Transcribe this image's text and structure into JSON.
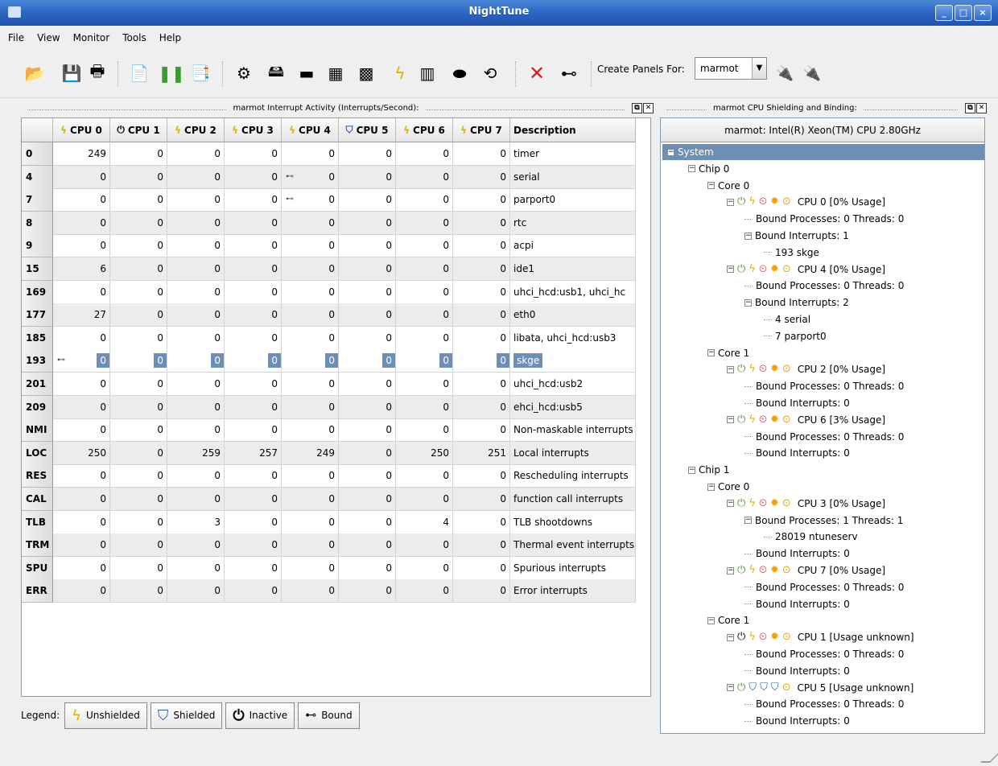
{
  "window": {
    "title": "NightTune",
    "controls": [
      "_",
      "□",
      "×"
    ]
  },
  "menu": [
    "File",
    "View",
    "Monitor",
    "Tools",
    "Help"
  ],
  "toolbar": {
    "create_panels_label": "Create Panels For:",
    "host": "marmot"
  },
  "interrupts_panel": {
    "title": "marmot Interrupt Activity (Interrupts/Second):",
    "columns": [
      "CPU 0",
      "CPU 1",
      "CPU 2",
      "CPU 3",
      "CPU 4",
      "CPU 5",
      "CPU 6",
      "CPU 7",
      "Description"
    ],
    "column_state": [
      "unshielded",
      "inactive",
      "unshielded",
      "unshielded",
      "unshielded",
      "shielded",
      "unshielded",
      "unshielded"
    ],
    "rows": [
      {
        "irq": "0",
        "values": [
          "249",
          "0",
          "0",
          "0",
          "0",
          "0",
          "0",
          "0"
        ],
        "desc": "timer"
      },
      {
        "irq": "4",
        "values": [
          "0",
          "0",
          "0",
          "0",
          "0",
          "0",
          "0",
          "0"
        ],
        "desc": "serial",
        "bound_cpu": 4
      },
      {
        "irq": "7",
        "values": [
          "0",
          "0",
          "0",
          "0",
          "0",
          "0",
          "0",
          "0"
        ],
        "desc": "parport0",
        "bound_cpu": 4
      },
      {
        "irq": "8",
        "values": [
          "0",
          "0",
          "0",
          "0",
          "0",
          "0",
          "0",
          "0"
        ],
        "desc": "rtc"
      },
      {
        "irq": "9",
        "values": [
          "0",
          "0",
          "0",
          "0",
          "0",
          "0",
          "0",
          "0"
        ],
        "desc": "acpi"
      },
      {
        "irq": "15",
        "values": [
          "6",
          "0",
          "0",
          "0",
          "0",
          "0",
          "0",
          "0"
        ],
        "desc": "ide1"
      },
      {
        "irq": "169",
        "values": [
          "0",
          "0",
          "0",
          "0",
          "0",
          "0",
          "0",
          "0"
        ],
        "desc": "uhci_hcd:usb1, uhci_hc"
      },
      {
        "irq": "177",
        "values": [
          "27",
          "0",
          "0",
          "0",
          "0",
          "0",
          "0",
          "0"
        ],
        "desc": "eth0"
      },
      {
        "irq": "185",
        "values": [
          "0",
          "0",
          "0",
          "0",
          "0",
          "0",
          "0",
          "0"
        ],
        "desc": "libata, uhci_hcd:usb3"
      },
      {
        "irq": "193",
        "values": [
          "0",
          "0",
          "0",
          "0",
          "0",
          "0",
          "0",
          "0"
        ],
        "desc": "skge",
        "selected": true,
        "bound_cpu": 0
      },
      {
        "irq": "201",
        "values": [
          "0",
          "0",
          "0",
          "0",
          "0",
          "0",
          "0",
          "0"
        ],
        "desc": "uhci_hcd:usb2"
      },
      {
        "irq": "209",
        "values": [
          "0",
          "0",
          "0",
          "0",
          "0",
          "0",
          "0",
          "0"
        ],
        "desc": "ehci_hcd:usb5"
      },
      {
        "irq": "NMI",
        "values": [
          "0",
          "0",
          "0",
          "0",
          "0",
          "0",
          "0",
          "0"
        ],
        "desc": "Non-maskable interrupts"
      },
      {
        "irq": "LOC",
        "values": [
          "250",
          "0",
          "259",
          "257",
          "249",
          "0",
          "250",
          "251"
        ],
        "desc": "Local interrupts"
      },
      {
        "irq": "RES",
        "values": [
          "0",
          "0",
          "0",
          "0",
          "0",
          "0",
          "0",
          "0"
        ],
        "desc": "Rescheduling interrupts"
      },
      {
        "irq": "CAL",
        "values": [
          "0",
          "0",
          "0",
          "0",
          "0",
          "0",
          "0",
          "0"
        ],
        "desc": "function call interrupts"
      },
      {
        "irq": "TLB",
        "values": [
          "0",
          "0",
          "3",
          "0",
          "0",
          "0",
          "4",
          "0"
        ],
        "desc": "TLB shootdowns"
      },
      {
        "irq": "TRM",
        "values": [
          "0",
          "0",
          "0",
          "0",
          "0",
          "0",
          "0",
          "0"
        ],
        "desc": "Thermal event interrupts"
      },
      {
        "irq": "SPU",
        "values": [
          "0",
          "0",
          "0",
          "0",
          "0",
          "0",
          "0",
          "0"
        ],
        "desc": "Spurious interrupts"
      },
      {
        "irq": "ERR",
        "values": [
          "0",
          "0",
          "0",
          "0",
          "0",
          "0",
          "0",
          "0"
        ],
        "desc": "Error interrupts"
      }
    ],
    "legend": {
      "label": "Legend:",
      "unshielded": "Unshielded",
      "shielded": "Shielded",
      "inactive": "Inactive",
      "bound": "Bound"
    }
  },
  "shielding_panel": {
    "title": "marmot CPU Shielding and Binding:",
    "header": "marmot:  Intel(R) Xeon(TM) CPU 2.80GHz",
    "tree": [
      {
        "label": "System",
        "kind": "system"
      },
      {
        "label": "Chip 0",
        "kind": "group",
        "level": 1
      },
      {
        "label": "Core 0",
        "kind": "group",
        "level": 2
      },
      {
        "label": "CPU 0   [0% Usage]",
        "kind": "cpu",
        "level": 3
      },
      {
        "label": "Bound Processes: 0 Threads: 0",
        "kind": "leaf",
        "level": 4
      },
      {
        "label": "Bound Interrupts: 1",
        "kind": "group",
        "level": 4
      },
      {
        "label": "193  skge",
        "kind": "leaf",
        "level": 5
      },
      {
        "label": "CPU 4   [0% Usage]",
        "kind": "cpu",
        "level": 3
      },
      {
        "label": "Bound Processes: 0 Threads: 0",
        "kind": "leaf",
        "level": 4
      },
      {
        "label": "Bound Interrupts: 2",
        "kind": "group",
        "level": 4
      },
      {
        "label": "4  serial",
        "kind": "leaf",
        "level": 5
      },
      {
        "label": "7  parport0",
        "kind": "leaf",
        "level": 5
      },
      {
        "label": "Core 1",
        "kind": "group",
        "level": 2
      },
      {
        "label": "CPU 2   [0% Usage]",
        "kind": "cpu",
        "level": 3
      },
      {
        "label": "Bound Processes: 0 Threads: 0",
        "kind": "leaf",
        "level": 4
      },
      {
        "label": "Bound Interrupts: 0",
        "kind": "leaf",
        "level": 4
      },
      {
        "label": "CPU 6   [3% Usage]",
        "kind": "cpu",
        "level": 3
      },
      {
        "label": "Bound Processes: 0 Threads: 0",
        "kind": "leaf",
        "level": 4
      },
      {
        "label": "Bound Interrupts: 0",
        "kind": "leaf",
        "level": 4
      },
      {
        "label": "Chip 1",
        "kind": "group",
        "level": 1
      },
      {
        "label": "Core 0",
        "kind": "group",
        "level": 2
      },
      {
        "label": "CPU 3   [0% Usage]",
        "kind": "cpu",
        "level": 3
      },
      {
        "label": "Bound Processes: 1 Threads: 1",
        "kind": "group",
        "level": 4
      },
      {
        "label": "28019 ntuneserv",
        "kind": "leaf",
        "level": 5
      },
      {
        "label": "Bound Interrupts: 0",
        "kind": "leaf",
        "level": 4
      },
      {
        "label": "CPU 7   [0% Usage]",
        "kind": "cpu",
        "level": 3
      },
      {
        "label": "Bound Processes: 0 Threads: 0",
        "kind": "leaf",
        "level": 4
      },
      {
        "label": "Bound Interrupts: 0",
        "kind": "leaf",
        "level": 4
      },
      {
        "label": "Core 1",
        "kind": "group",
        "level": 2
      },
      {
        "label": "CPU 1   [Usage unknown]",
        "kind": "cpu",
        "level": 3,
        "state": "inactive"
      },
      {
        "label": "Bound Processes: 0 Threads: 0",
        "kind": "leaf",
        "level": 4
      },
      {
        "label": "Bound Interrupts: 0",
        "kind": "leaf",
        "level": 4
      },
      {
        "label": "CPU 5   [Usage unknown]",
        "kind": "cpu",
        "level": 3,
        "state": "shielded"
      },
      {
        "label": "Bound Processes: 0 Threads: 0",
        "kind": "leaf",
        "level": 4
      },
      {
        "label": "Bound Interrupts: 0",
        "kind": "leaf",
        "level": 4
      }
    ]
  },
  "colors": {
    "titlebar": "#2a62c0",
    "selection": "#6e8fb5",
    "unshielded": "#d8b400",
    "shielded": "#2b5ca8",
    "inactive_power": "#4a9a2c"
  }
}
